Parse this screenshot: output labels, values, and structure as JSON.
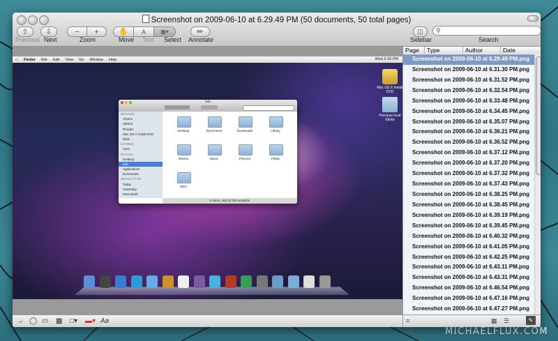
{
  "window": {
    "title": "Screenshot on 2009-06-10 at 6.29.49 PM (50 documents, 50 total pages)"
  },
  "toolbar": {
    "previous": "Previous",
    "next": "Next",
    "zoom": "Zoom",
    "move": "Move",
    "text": "Text",
    "select": "Select",
    "annotate": "Annotate",
    "sidebar": "Sidebar",
    "search": "Search",
    "search_value": ""
  },
  "embedded_desktop": {
    "menubar": [
      "Finder",
      "File",
      "Edit",
      "View",
      "Go",
      "Window",
      "Help"
    ],
    "clock": "Wed 6:29 PM",
    "desktop_icons": [
      {
        "label": "Mac OS X Install DVD",
        "icon": "dvd-icon"
      },
      {
        "label": "Previous local iDisks",
        "icon": "folder-icon"
      }
    ],
    "finder": {
      "title": "bob",
      "sidebar": [
        {
          "text": "DEVICES",
          "header": true
        },
        {
          "text": "Athens"
        },
        {
          "text": "Athens"
        },
        {
          "text": "Rhodes"
        },
        {
          "text": "Mac OS X Install DVD"
        },
        {
          "text": "iDisk"
        },
        {
          "text": "SHARED",
          "header": true
        },
        {
          "text": "Aeris"
        },
        {
          "text": "PLACES",
          "header": true
        },
        {
          "text": "Desktop"
        },
        {
          "text": "bob",
          "selected": true
        },
        {
          "text": "Applications"
        },
        {
          "text": "Documents"
        },
        {
          "text": "SEARCH FOR",
          "header": true
        },
        {
          "text": "Today"
        },
        {
          "text": "Yesterday"
        },
        {
          "text": "Past Week"
        }
      ],
      "folders": [
        "Desktop",
        "Documents",
        "Downloads",
        "Library",
        "Movies",
        "Music",
        "Pictures",
        "Public",
        "Sites"
      ],
      "status": "9 items, 493.23 GB available"
    }
  },
  "panel": {
    "columns": [
      "Page",
      "Type",
      "Author",
      "Date"
    ],
    "documents": [
      "Screenshot on 2009-06-10 at 6.29.49 PM.png",
      "Screenshot on 2009-06-10 at 6.31.30 PM.png",
      "Screenshot on 2009-06-10 at 6.31.52 PM.png",
      "Screenshot on 2009-06-10 at 6.32.54 PM.png",
      "Screenshot on 2009-06-10 at 6.33.48 PM.png",
      "Screenshot on 2009-06-10 at 6.34.45 PM.png",
      "Screenshot on 2009-06-10 at 6.35.07 PM.png",
      "Screenshot on 2009-06-10 at 6.36.21 PM.png",
      "Screenshot on 2009-06-10 at 6.36.52 PM.png",
      "Screenshot on 2009-06-10 at 6.37.12 PM.png",
      "Screenshot on 2009-06-10 at 6.37.20 PM.png",
      "Screenshot on 2009-06-10 at 6.37.32 PM.png",
      "Screenshot on 2009-06-10 at 6.37.43 PM.png",
      "Screenshot on 2009-06-10 at 6.38.25 PM.png",
      "Screenshot on 2009-06-10 at 6.38.45 PM.png",
      "Screenshot on 2009-06-10 at 6.39.19 PM.png",
      "Screenshot on 2009-06-10 at 6.39.45 PM.png",
      "Screenshot on 2009-06-10 at 6.40.32 PM.png",
      "Screenshot on 2009-06-10 at 6.41.05 PM.png",
      "Screenshot on 2009-06-10 at 6.42.25 PM.png",
      "Screenshot on 2009-06-10 at 6.43.11 PM.png",
      "Screenshot on 2009-06-10 at 6.43.31 PM.png",
      "Screenshot on 2009-06-10 at 6.46.54 PM.png",
      "Screenshot on 2009-06-10 at 6.47.16 PM.png",
      "Screenshot on 2009-06-10 at 6.47.27 PM.png"
    ],
    "selected_index": 0
  },
  "watermark": "MICHAELFLUX.COM",
  "colors": {
    "selection": "#7e9ac4",
    "background_teal": "#3f8a98"
  }
}
